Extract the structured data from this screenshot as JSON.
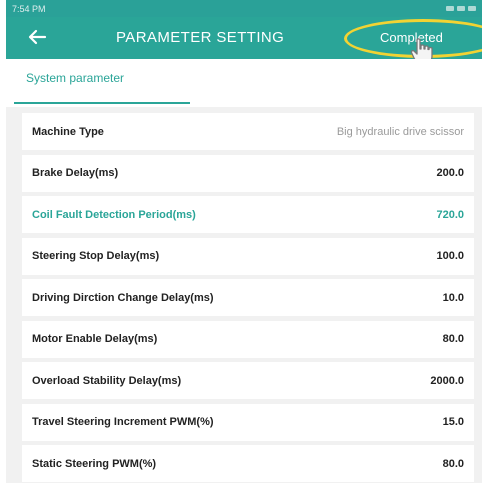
{
  "status_bar": {
    "time": "7:54 PM"
  },
  "header": {
    "back_icon": "back-arrow-icon",
    "title": "PARAMETER SETTING",
    "action": "Completed"
  },
  "tabs": [
    {
      "label": "System parameter"
    }
  ],
  "colors": {
    "accent": "#2aa598",
    "highlight": "#f2d333"
  },
  "params": [
    {
      "label": "Machine Type",
      "value": "Big hydraulic drive scissor",
      "active": false
    },
    {
      "label": "Brake Delay(ms)",
      "value": "200.0",
      "active": false
    },
    {
      "label": "Coil Fault Detection Period(ms)",
      "value": "720.0",
      "active": true
    },
    {
      "label": "Steering Stop Delay(ms)",
      "value": "100.0",
      "active": false
    },
    {
      "label": "Driving Dirction Change Delay(ms)",
      "value": "10.0",
      "active": false
    },
    {
      "label": "Motor Enable Delay(ms)",
      "value": "80.0",
      "active": false
    },
    {
      "label": "Overload Stability Delay(ms)",
      "value": "2000.0",
      "active": false
    },
    {
      "label": "Travel Steering Increment PWM(%)",
      "value": "15.0",
      "active": false
    },
    {
      "label": "Static Steering PWM(%)",
      "value": "80.0",
      "active": false
    }
  ]
}
